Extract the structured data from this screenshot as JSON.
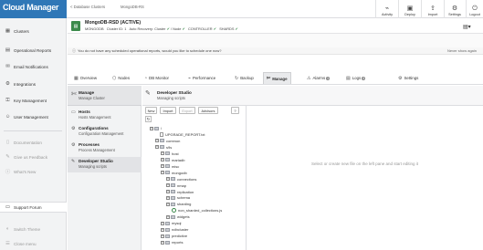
{
  "app": {
    "logo_text": "Cloud Manager"
  },
  "topbar": {
    "back_label": "< Database Clusters",
    "deployment": "MongoDB-RS",
    "buttons": [
      {
        "label": "Activity",
        "icon": "activity-icon"
      },
      {
        "label": "Deploy",
        "icon": "deploy-icon"
      },
      {
        "label": "Import",
        "icon": "import-icon"
      },
      {
        "label": "Settings",
        "icon": "gear-icon"
      },
      {
        "label": "Logout",
        "icon": "logout-icon"
      }
    ]
  },
  "sidebar": {
    "items": [
      {
        "label": "Clusters",
        "icon": "clusters-icon"
      },
      {
        "label": "Operational Reports",
        "icon": "reports-icon"
      },
      {
        "label": "Email Notifications",
        "icon": "email-icon"
      },
      {
        "label": "Integrations",
        "icon": "integrations-icon"
      },
      {
        "label": "Key Management",
        "icon": "key-icon"
      },
      {
        "label": "User Management",
        "icon": "user-icon"
      }
    ],
    "secondary": [
      {
        "label": "Documentation",
        "icon": "docs-icon"
      },
      {
        "label": "Give us Feedback",
        "icon": "feedback-icon"
      },
      {
        "label": "What's New",
        "icon": "info-icon"
      }
    ],
    "support_label": "Support Forum",
    "bottom": [
      {
        "label": "Switch Theme",
        "icon": "theme-icon"
      },
      {
        "label": "Close menu",
        "icon": "close-menu-icon"
      }
    ]
  },
  "cluster": {
    "name": "MongoDB-RSD (ACTIVE)",
    "type": "MONGODB",
    "cluster_id": "Cluster ID: 1",
    "auto_recovery": "Auto Recovery: Cluster",
    "node": "Node",
    "controller": "CONTROLLER",
    "shards": "SHARDS"
  },
  "alert": {
    "text": "You do not have any scheduled operational reports, would you like to schedule one now?",
    "dismiss": "Never show again"
  },
  "tabs": [
    {
      "label": "Overview",
      "icon": "overview-icon"
    },
    {
      "label": "Nodes",
      "icon": "nodes-icon"
    },
    {
      "label": "DB Monitor",
      "icon": "monitor-icon"
    },
    {
      "label": "Performance",
      "icon": "performance-icon"
    },
    {
      "label": "Backup",
      "icon": "backup-icon"
    },
    {
      "label": "Manage",
      "icon": "wrench-icon",
      "active": true
    },
    {
      "label": "Alarms",
      "icon": "alarm-icon",
      "count": "1"
    },
    {
      "label": "Logs",
      "icon": "logs-icon",
      "count": "4"
    },
    {
      "label": "Settings",
      "icon": "gear-icon"
    }
  ],
  "manage": {
    "title": "Manage",
    "subtitle": "Manage Cluster",
    "items": [
      {
        "title": "Hosts",
        "subtitle": "Hosts Management"
      },
      {
        "title": "Configurations",
        "subtitle": "Configuration Management"
      },
      {
        "title": "Processes",
        "subtitle": "Process Management"
      },
      {
        "title": "Developer Studio",
        "subtitle": "Managing scripts",
        "active": true
      }
    ]
  },
  "dev_studio": {
    "title": "Developer Studio",
    "subtitle": "Managing scripts",
    "toolbar": [
      "New",
      "Import",
      "Export",
      "Advisors",
      "?"
    ],
    "placeholder": "Select or create new file on the left pane and start editing it"
  },
  "tree": [
    {
      "label": "/",
      "level": 0,
      "kind": "root"
    },
    {
      "label": "UPGRADE_REPORT.txt",
      "level": 1,
      "kind": "file"
    },
    {
      "label": "common",
      "level": 1,
      "kind": "folder"
    },
    {
      "label": "s9s",
      "level": 1,
      "kind": "folder"
    },
    {
      "label": "host",
      "level": 2,
      "kind": "folder"
    },
    {
      "label": "mariadb",
      "level": 2,
      "kind": "folder"
    },
    {
      "label": "misc",
      "level": 2,
      "kind": "folder"
    },
    {
      "label": "mongodb",
      "level": 2,
      "kind": "folder"
    },
    {
      "label": "connections",
      "level": 3,
      "kind": "folder"
    },
    {
      "label": "nmap",
      "level": 3,
      "kind": "folder"
    },
    {
      "label": "replication",
      "level": 3,
      "kind": "folder"
    },
    {
      "label": "schema",
      "level": 3,
      "kind": "folder"
    },
    {
      "label": "sharding",
      "level": 3,
      "kind": "folder"
    },
    {
      "label": "non_sharded_collections.js",
      "level": 4,
      "kind": "script"
    },
    {
      "label": "widgets",
      "level": 3,
      "kind": "folder"
    },
    {
      "label": "mysql",
      "level": 2,
      "kind": "folder"
    },
    {
      "label": "ndbcluster",
      "level": 2,
      "kind": "folder"
    },
    {
      "label": "predictive",
      "level": 2,
      "kind": "folder"
    },
    {
      "label": "reports",
      "level": 2,
      "kind": "folder"
    }
  ]
}
